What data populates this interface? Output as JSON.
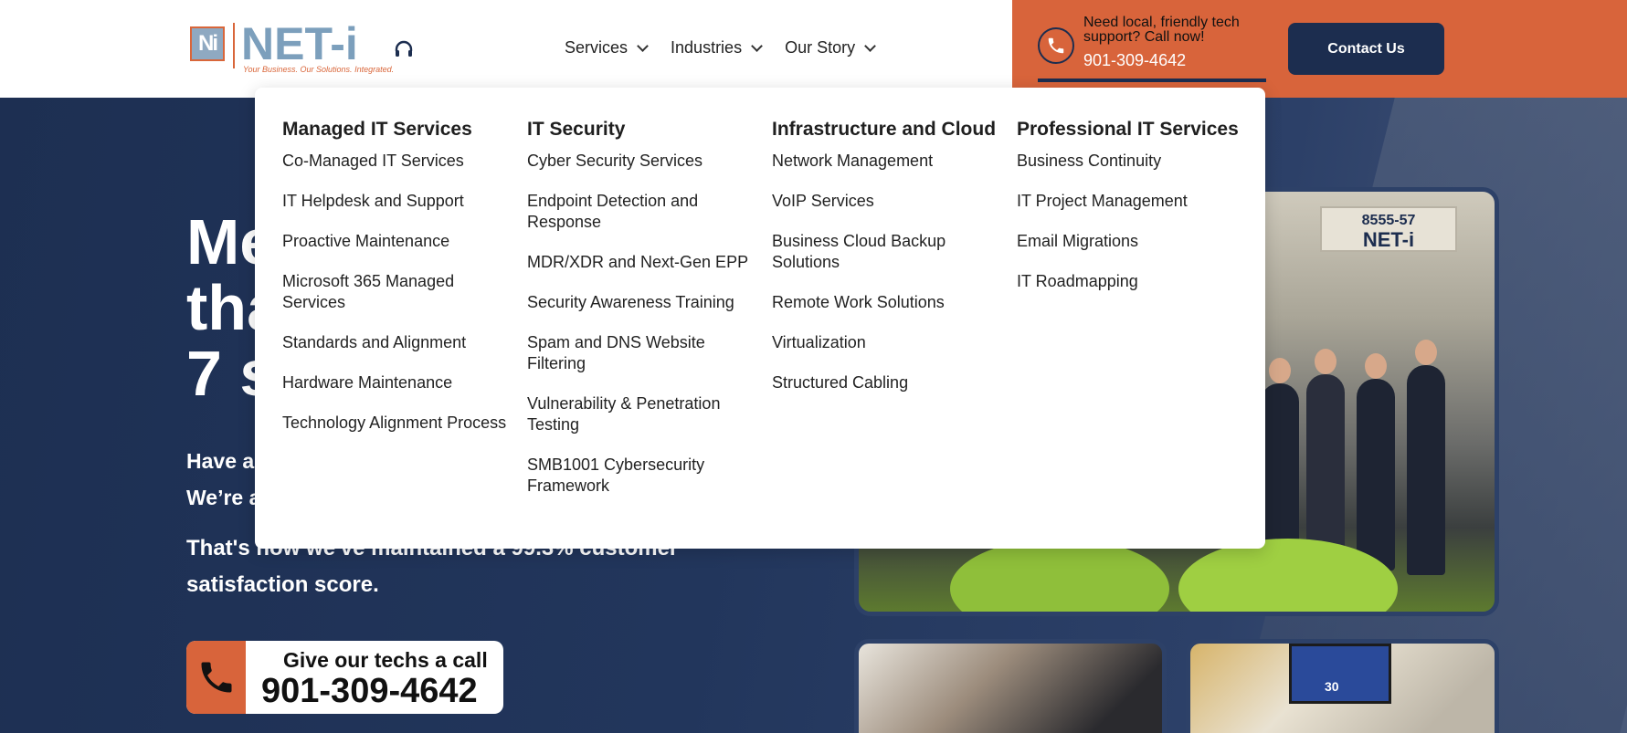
{
  "header": {
    "logo": {
      "mark": "Ni",
      "word": "NET-i",
      "tagline": "Your Business. Our Solutions. Integrated."
    },
    "nav": [
      {
        "label": "Services"
      },
      {
        "label": "Industries"
      },
      {
        "label": "Our Story"
      }
    ],
    "call": {
      "line1": "Need local, friendly tech support? Call now!",
      "number": "901-309-4642"
    },
    "contact_label": "Contact Us",
    "colors": {
      "accent": "#d8643b",
      "navy": "#1c2d4f",
      "logo_blue": "#7c9fbc"
    }
  },
  "hero": {
    "heading_lines": [
      "Me",
      "tha",
      "7 s"
    ],
    "p1_lines": [
      "Have a",
      "We’re a"
    ],
    "p2": "That's how we've maintained a 99.3% customer satisfaction score.",
    "cta": {
      "label": "Give our techs a call",
      "number": "901-309-4642"
    },
    "photo": {
      "sign_number": "8555-57",
      "sign_name": "NET-i"
    },
    "tv_number": "30"
  },
  "mega_menu": {
    "columns": [
      {
        "title": "Managed IT Services",
        "items": [
          "Co-Managed IT Services",
          "IT Helpdesk and Support",
          "Proactive Maintenance",
          "Microsoft 365 Managed Services",
          "Standards and Alignment",
          "Hardware Maintenance",
          "Technology Alignment Process"
        ]
      },
      {
        "title": "IT Security",
        "items": [
          "Cyber Security Services",
          "Endpoint Detection and Response",
          "MDR/XDR and Next-Gen EPP",
          "Security Awareness Training",
          "Spam and DNS Website Filtering",
          "Vulnerability & Penetration Testing",
          "SMB1001 Cybersecurity Framework"
        ]
      },
      {
        "title": "Infrastructure and Cloud",
        "items": [
          "Network Management",
          "VoIP Services",
          "Business Cloud Backup Solutions",
          "Remote Work Solutions",
          "Virtualization",
          "Structured Cabling"
        ]
      },
      {
        "title": "Professional IT Services",
        "items": [
          "Business Continuity",
          "IT Project Management",
          "Email Migrations",
          "IT Roadmapping"
        ]
      }
    ]
  }
}
